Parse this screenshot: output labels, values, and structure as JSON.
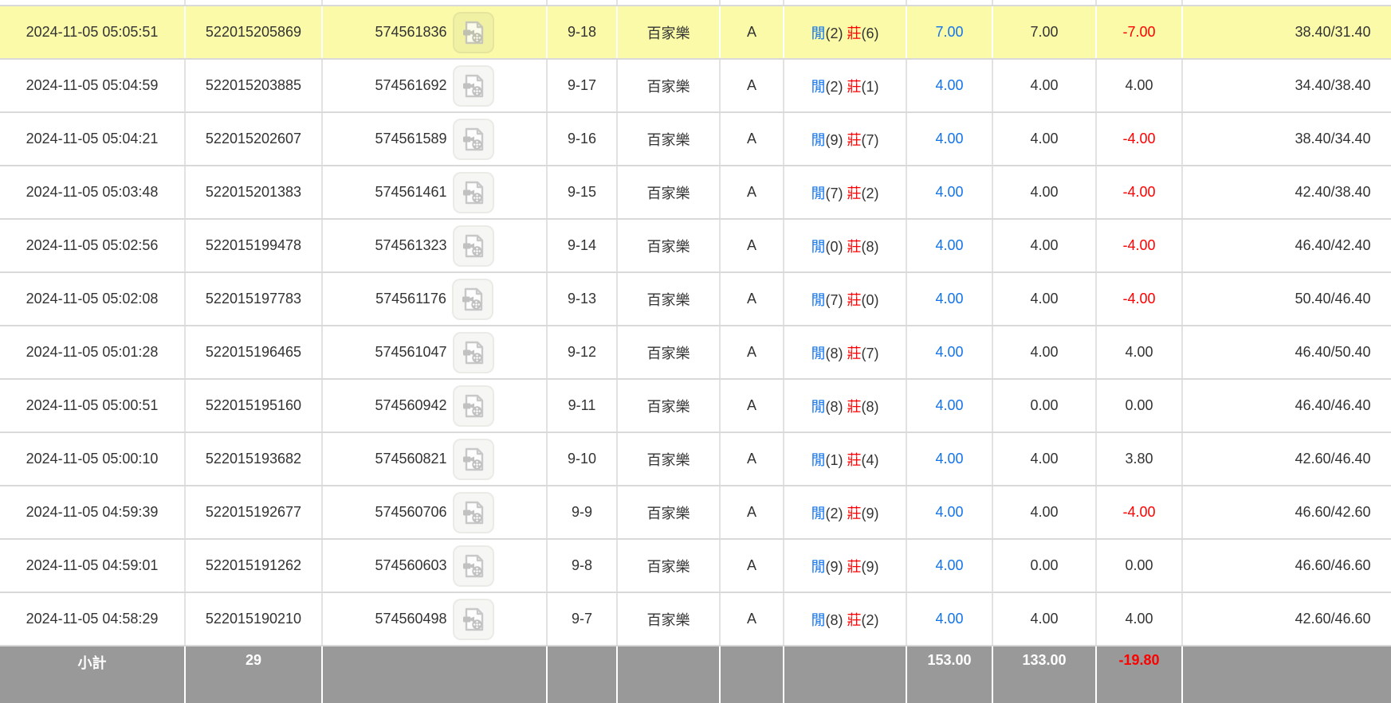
{
  "colors": {
    "highlight_row": "#fafaa8",
    "link_blue": "#1273eb",
    "negative_red": "#fe0000",
    "summary_bg": "#999999",
    "summary_text": "#ffffff",
    "row_border": "#d9d9d9",
    "cell_text": "#333333"
  },
  "icons": {
    "replay": "video-replay-icon"
  },
  "table": {
    "rows": [
      {
        "time": "2024-11-05 05:05:51",
        "bet_id": "522015205869",
        "game_id": "574561836",
        "round": "9-18",
        "game": "百家樂",
        "table_code": "A",
        "result": {
          "p_label": "閒",
          "p_score": "(2)",
          "b_label": "莊",
          "b_score": "(6)"
        },
        "bet": "7.00",
        "valid": "7.00",
        "win_loss": "-7.00",
        "balance": "38.40/31.40",
        "highlighted": true
      },
      {
        "time": "2024-11-05 05:04:59",
        "bet_id": "522015203885",
        "game_id": "574561692",
        "round": "9-17",
        "game": "百家樂",
        "table_code": "A",
        "result": {
          "p_label": "閒",
          "p_score": "(2)",
          "b_label": "莊",
          "b_score": "(1)"
        },
        "bet": "4.00",
        "valid": "4.00",
        "win_loss": "4.00",
        "balance": "34.40/38.40",
        "highlighted": false
      },
      {
        "time": "2024-11-05 05:04:21",
        "bet_id": "522015202607",
        "game_id": "574561589",
        "round": "9-16",
        "game": "百家樂",
        "table_code": "A",
        "result": {
          "p_label": "閒",
          "p_score": "(9)",
          "b_label": "莊",
          "b_score": "(7)"
        },
        "bet": "4.00",
        "valid": "4.00",
        "win_loss": "-4.00",
        "balance": "38.40/34.40",
        "highlighted": false
      },
      {
        "time": "2024-11-05 05:03:48",
        "bet_id": "522015201383",
        "game_id": "574561461",
        "round": "9-15",
        "game": "百家樂",
        "table_code": "A",
        "result": {
          "p_label": "閒",
          "p_score": "(7)",
          "b_label": "莊",
          "b_score": "(2)"
        },
        "bet": "4.00",
        "valid": "4.00",
        "win_loss": "-4.00",
        "balance": "42.40/38.40",
        "highlighted": false
      },
      {
        "time": "2024-11-05 05:02:56",
        "bet_id": "522015199478",
        "game_id": "574561323",
        "round": "9-14",
        "game": "百家樂",
        "table_code": "A",
        "result": {
          "p_label": "閒",
          "p_score": "(0)",
          "b_label": "莊",
          "b_score": "(8)"
        },
        "bet": "4.00",
        "valid": "4.00",
        "win_loss": "-4.00",
        "balance": "46.40/42.40",
        "highlighted": false
      },
      {
        "time": "2024-11-05 05:02:08",
        "bet_id": "522015197783",
        "game_id": "574561176",
        "round": "9-13",
        "game": "百家樂",
        "table_code": "A",
        "result": {
          "p_label": "閒",
          "p_score": "(7)",
          "b_label": "莊",
          "b_score": "(0)"
        },
        "bet": "4.00",
        "valid": "4.00",
        "win_loss": "-4.00",
        "balance": "50.40/46.40",
        "highlighted": false
      },
      {
        "time": "2024-11-05 05:01:28",
        "bet_id": "522015196465",
        "game_id": "574561047",
        "round": "9-12",
        "game": "百家樂",
        "table_code": "A",
        "result": {
          "p_label": "閒",
          "p_score": "(8)",
          "b_label": "莊",
          "b_score": "(7)"
        },
        "bet": "4.00",
        "valid": "4.00",
        "win_loss": "4.00",
        "balance": "46.40/50.40",
        "highlighted": false
      },
      {
        "time": "2024-11-05 05:00:51",
        "bet_id": "522015195160",
        "game_id": "574560942",
        "round": "9-11",
        "game": "百家樂",
        "table_code": "A",
        "result": {
          "p_label": "閒",
          "p_score": "(8)",
          "b_label": "莊",
          "b_score": "(8)"
        },
        "bet": "4.00",
        "valid": "0.00",
        "win_loss": "0.00",
        "balance": "46.40/46.40",
        "highlighted": false
      },
      {
        "time": "2024-11-05 05:00:10",
        "bet_id": "522015193682",
        "game_id": "574560821",
        "round": "9-10",
        "game": "百家樂",
        "table_code": "A",
        "result": {
          "p_label": "閒",
          "p_score": "(1)",
          "b_label": "莊",
          "b_score": "(4)"
        },
        "bet": "4.00",
        "valid": "4.00",
        "win_loss": "3.80",
        "balance": "42.60/46.40",
        "highlighted": false
      },
      {
        "time": "2024-11-05 04:59:39",
        "bet_id": "522015192677",
        "game_id": "574560706",
        "round": "9-9",
        "game": "百家樂",
        "table_code": "A",
        "result": {
          "p_label": "閒",
          "p_score": "(2)",
          "b_label": "莊",
          "b_score": "(9)"
        },
        "bet": "4.00",
        "valid": "4.00",
        "win_loss": "-4.00",
        "balance": "46.60/42.60",
        "highlighted": false
      },
      {
        "time": "2024-11-05 04:59:01",
        "bet_id": "522015191262",
        "game_id": "574560603",
        "round": "9-8",
        "game": "百家樂",
        "table_code": "A",
        "result": {
          "p_label": "閒",
          "p_score": "(9)",
          "b_label": "莊",
          "b_score": "(9)"
        },
        "bet": "4.00",
        "valid": "0.00",
        "win_loss": "0.00",
        "balance": "46.60/46.60",
        "highlighted": false
      },
      {
        "time": "2024-11-05 04:58:29",
        "bet_id": "522015190210",
        "game_id": "574560498",
        "round": "9-7",
        "game": "百家樂",
        "table_code": "A",
        "result": {
          "p_label": "閒",
          "p_score": "(8)",
          "b_label": "莊",
          "b_score": "(2)"
        },
        "bet": "4.00",
        "valid": "4.00",
        "win_loss": "4.00",
        "balance": "42.60/46.60",
        "highlighted": false
      }
    ],
    "summary": {
      "label": "小計",
      "count": "29",
      "bet_total": "153.00",
      "valid_total": "133.00",
      "win_loss_total": "-19.80"
    }
  }
}
